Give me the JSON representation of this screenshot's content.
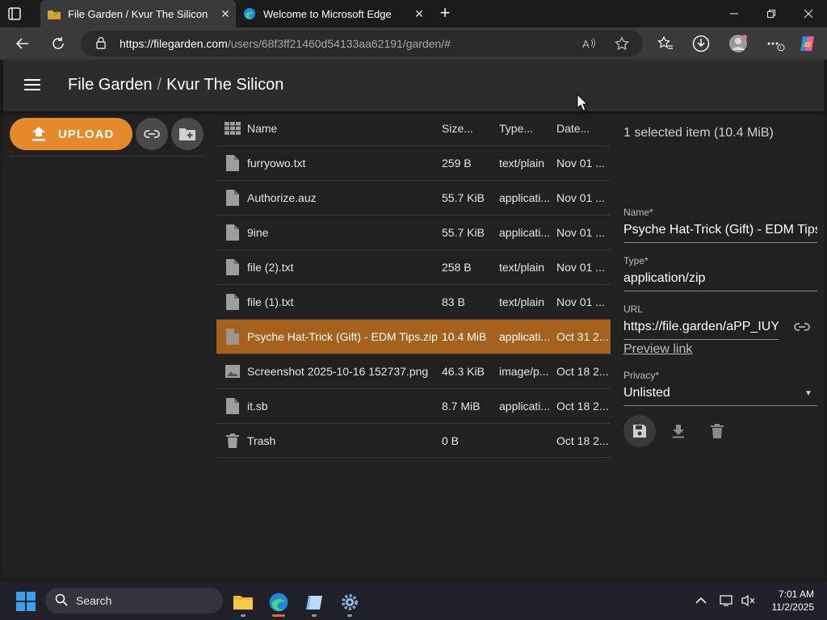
{
  "browser": {
    "tabs": [
      {
        "title": "File Garden / Kvur The Silicon",
        "active": true
      },
      {
        "title": "Welcome to Microsoft Edge",
        "active": false
      }
    ],
    "new_tab_label": "+",
    "url": {
      "host": "https://filegarden.com",
      "rest": "/users/68f3ff21460d54133aa62191/garden/#"
    }
  },
  "app": {
    "title": "File Garden",
    "separator": "/",
    "subtitle": "Kvur The Silicon",
    "upload_label": "UPLOAD",
    "accent_color": "#e6892b",
    "selected_row_color": "#a6621c"
  },
  "table": {
    "headers": {
      "name": "Name",
      "size": "Size...",
      "type": "Type...",
      "date": "Date..."
    },
    "rows": [
      {
        "icon": "file-icon",
        "name": "furryowo.txt",
        "size": "259 B",
        "type": "text/plain",
        "date": "Nov 01 ..."
      },
      {
        "icon": "file-icon",
        "name": "Authorize.auz",
        "size": "55.7 KiB",
        "type": "applicati...",
        "date": "Nov 01 ..."
      },
      {
        "icon": "file-icon",
        "name": "9ine",
        "size": "55.7 KiB",
        "type": "applicati...",
        "date": "Nov 01 ..."
      },
      {
        "icon": "file-icon",
        "name": "file (2).txt",
        "size": "258 B",
        "type": "text/plain",
        "date": "Nov 01 ..."
      },
      {
        "icon": "file-icon",
        "name": "file (1).txt",
        "size": "83 B",
        "type": "text/plain",
        "date": "Nov 01 ..."
      },
      {
        "icon": "file-icon",
        "name": "Psyche Hat-Trick (Gift) - EDM Tips.zip",
        "size": "10.4 MiB",
        "type": "applicati...",
        "date": "Oct 31 2...",
        "selected": true
      },
      {
        "icon": "image-icon",
        "name": "Screenshot 2025-10-16 152737.png",
        "size": "46.3 KiB",
        "type": "image/p...",
        "date": "Oct 18 2..."
      },
      {
        "icon": "file-icon",
        "name": "it.sb",
        "size": "8.7 MiB",
        "type": "applicati...",
        "date": "Oct 18 2..."
      },
      {
        "icon": "trash-icon",
        "name": "Trash",
        "size": "0 B",
        "type": "",
        "date": "Oct 18 2..."
      }
    ]
  },
  "details": {
    "selection_summary": "1 selected item (10.4 MiB)",
    "name_label": "Name*",
    "name_value": "Psyche Hat-Trick (Gift) - EDM Tips.zip",
    "type_label": "Type*",
    "type_value": "application/zip",
    "url_label": "URL",
    "url_value": "https://file.garden/aPP_IUY",
    "preview_link": "Preview link",
    "privacy_label": "Privacy*",
    "privacy_value": "Unlisted"
  },
  "taskbar": {
    "search_label": "Search",
    "time": "7:01 AM",
    "date": "11/2/2025"
  }
}
